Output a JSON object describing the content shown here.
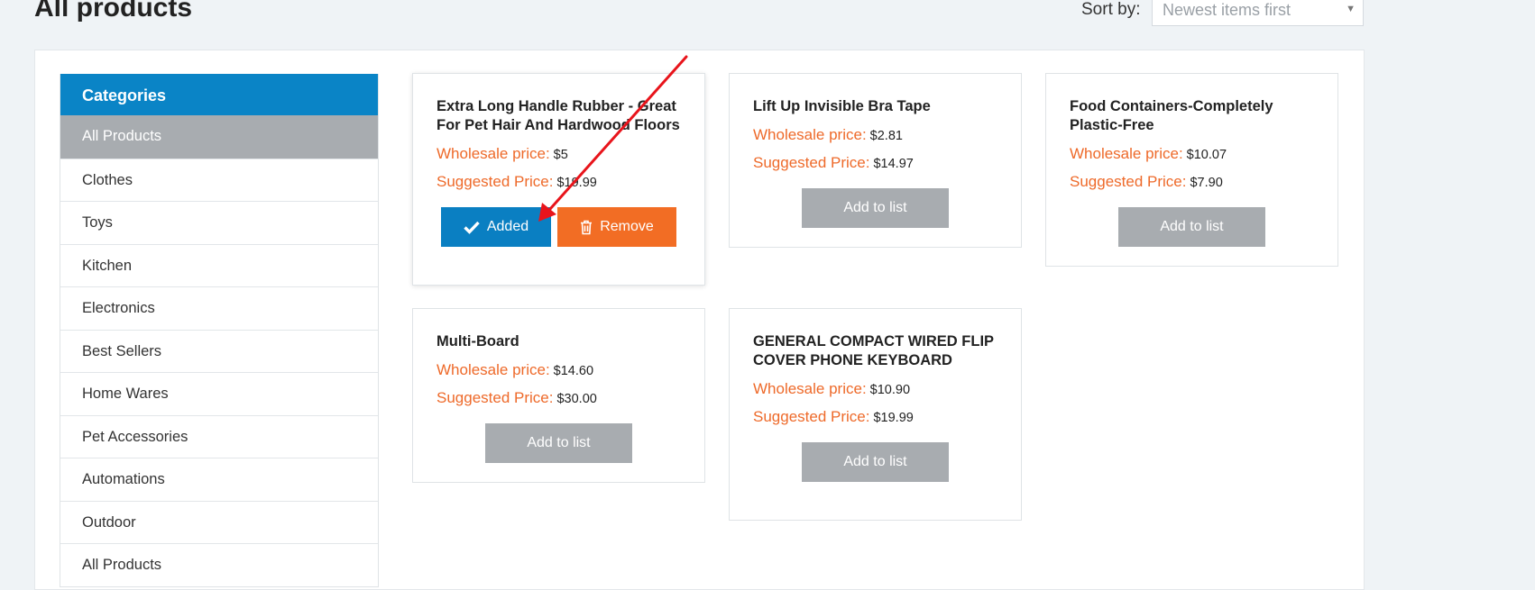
{
  "page": {
    "title": "All products"
  },
  "sort": {
    "label": "Sort by:",
    "selected": "Newest items first"
  },
  "categories": {
    "header": "Categories",
    "items": [
      {
        "label": "All Products"
      },
      {
        "label": "Clothes"
      },
      {
        "label": "Toys"
      },
      {
        "label": "Kitchen"
      },
      {
        "label": "Electronics"
      },
      {
        "label": "Best Sellers"
      },
      {
        "label": "Home Wares"
      },
      {
        "label": "Pet Accessories"
      },
      {
        "label": "Automations"
      },
      {
        "label": "Outdoor"
      },
      {
        "label": "All Products"
      }
    ]
  },
  "labels": {
    "wholesale": "Wholesale price:",
    "suggested": "Suggested Price:",
    "add": "Add to list",
    "added": "Added",
    "remove": "Remove"
  },
  "products": [
    {
      "title": "Extra Long Handle Rubber - Great For Pet Hair And Hardwood Floors",
      "wholesale": "$5",
      "suggested": "$19.99",
      "state": "added"
    },
    {
      "title": "Lift Up Invisible Bra Tape",
      "wholesale": "$2.81",
      "suggested": "$14.97",
      "state": "not-added"
    },
    {
      "title": "Food Containers-Completely Plastic-Free",
      "wholesale": "$10.07",
      "suggested": "$7.90",
      "state": "not-added"
    },
    {
      "title": "Multi-Board",
      "wholesale": "$14.60",
      "suggested": "$30.00",
      "state": "not-added"
    },
    {
      "title": "GENERAL COMPACT WIRED FLIP COVER PHONE KEYBOARD",
      "wholesale": "$10.90",
      "suggested": "$19.99",
      "state": "not-added"
    }
  ],
  "colors": {
    "accent_blue": "#0a84c6",
    "accent_orange": "#f26d24",
    "price_orange": "#ee6a2a",
    "button_gray": "#a8acb0",
    "annotation_red": "#e8141b"
  },
  "icons": {
    "added": "check-icon",
    "remove": "trash-icon",
    "sort": "caret-down-icon"
  }
}
